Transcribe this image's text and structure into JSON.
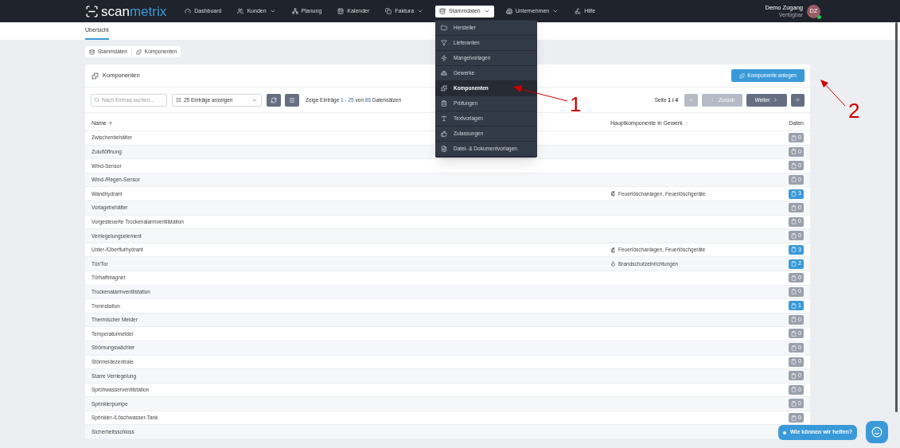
{
  "nav": {
    "logo": {
      "prefix": "scan",
      "suffix": "metrix"
    },
    "items": [
      {
        "label": "Dashboard",
        "dropdown": false,
        "selected": false
      },
      {
        "label": "Kunden",
        "dropdown": true,
        "selected": false
      },
      {
        "label": "Planung",
        "dropdown": false,
        "selected": false
      },
      {
        "label": "Kalender",
        "dropdown": false,
        "selected": false
      },
      {
        "label": "Faktura",
        "dropdown": true,
        "selected": false
      },
      {
        "label": "Stammdaten",
        "dropdown": true,
        "selected": true
      },
      {
        "label": "Unternehmen",
        "dropdown": true,
        "selected": false
      },
      {
        "label": "Hilfe",
        "dropdown": false,
        "selected": false
      }
    ],
    "user": {
      "name": "Demo Zugang",
      "status": "Verfügbar",
      "initials": "DZ",
      "online": true
    }
  },
  "menu": [
    {
      "label": "Hersteller",
      "selected": false
    },
    {
      "label": "Lieferanten",
      "selected": false
    },
    {
      "label": "Mangelvorlagen",
      "selected": false
    },
    {
      "label": "Gewerke",
      "selected": false
    },
    {
      "label": "Komponenten",
      "selected": true
    },
    {
      "label": "Prüfungen",
      "selected": false
    },
    {
      "label": "Textvorlagen",
      "selected": false
    },
    {
      "label": "Zulassungen",
      "selected": false
    },
    {
      "label": "Datei- & Dokumentvorlagen",
      "selected": false
    }
  ],
  "subtabs": [
    {
      "label": "Übersicht",
      "selected": true
    }
  ],
  "breadcrumb": [
    "Stammdaten",
    "Komponenten"
  ],
  "card": {
    "title": "Komponenten",
    "create_button": "Komponente anlegen",
    "search": {
      "placeholder": "Nach Eintrag suchen..."
    },
    "page_size": "25 Einträge anzeigen",
    "info": [
      {
        "text": "Zeige Einträge ",
        "highlight": false
      },
      {
        "text": "1 - 25",
        "highlight": true
      },
      {
        "text": " von ",
        "highlight": false
      },
      {
        "text": "86",
        "highlight": true
      },
      {
        "text": " Datensätzen",
        "highlight": false
      }
    ],
    "page": "Seite **1 / 4**",
    "pager": [
      {
        "kind": "first",
        "disabled": true
      },
      {
        "kind": "prev",
        "label": "Zurück",
        "disabled": true
      },
      {
        "kind": "next",
        "label": "Weiter",
        "disabled": false
      },
      {
        "kind": "last",
        "disabled": false
      }
    ]
  },
  "table": {
    "columns": [
      {
        "label": "Name",
        "sorted": true
      },
      {
        "label": "Hauptkomponente in Gewerk",
        "sorted": false
      },
      {
        "label": "Daten"
      }
    ],
    "rows": [
      {
        "name": "Zwischenbehälter",
        "count": "0",
        "active": false
      },
      {
        "name": "Zuluftöffnung",
        "count": "0",
        "active": false
      },
      {
        "name": "Wind-Sensor",
        "count": "0",
        "active": false
      },
      {
        "name": "Wind-/Regen-Sensor",
        "count": "0",
        "active": false
      },
      {
        "name": "Wandhydrant",
        "gewerk": {
          "kind": "extinguisher",
          "text": "Feuerlöschanlagen, Feuerlöschgeräte"
        },
        "count": "3",
        "active": true
      },
      {
        "name": "Vorlagebehälter",
        "count": "0",
        "active": false
      },
      {
        "name": "Vorgesteuerte Trockenalarmventilstation",
        "count": "0",
        "active": false
      },
      {
        "name": "Verriegelungselement",
        "count": "0",
        "active": false
      },
      {
        "name": "Unter-/Überflurhydrant",
        "gewerk": {
          "kind": "extinguisher",
          "text": "Feuerlöschanlagen, Feuerlöschgeräte"
        },
        "count": "3",
        "active": true
      },
      {
        "name": "Tür/Tor",
        "gewerk": {
          "kind": "flame",
          "text": "Brandschutzeinrichtungen"
        },
        "count": "2",
        "active": true
      },
      {
        "name": "Türhaftmagnet",
        "count": "0",
        "active": false
      },
      {
        "name": "Trockenalarmventilstation",
        "count": "0",
        "active": false
      },
      {
        "name": "Trennstation",
        "count": "1",
        "active": true
      },
      {
        "name": "Thermischer Melder",
        "count": "0",
        "active": false
      },
      {
        "name": "Temperaturmelder",
        "count": "0",
        "active": false
      },
      {
        "name": "Strömungswächter",
        "count": "0",
        "active": false
      },
      {
        "name": "Störmeldezentrale",
        "count": "0",
        "active": false
      },
      {
        "name": "Starre Verriegelung",
        "count": "0",
        "active": false
      },
      {
        "name": "Sprühwasserventilstation",
        "count": "0",
        "active": false
      },
      {
        "name": "Sprinklerpumpe",
        "count": "0",
        "active": false
      },
      {
        "name": "Sprinkler-/Löschwasser-Tank",
        "count": "0",
        "active": false
      },
      {
        "name": "Sicherheitsschloss"
      }
    ]
  },
  "annotations": [
    {
      "label": "1"
    },
    {
      "label": "2"
    }
  ],
  "chat": {
    "prompt": "Wie können wir helfen?"
  }
}
